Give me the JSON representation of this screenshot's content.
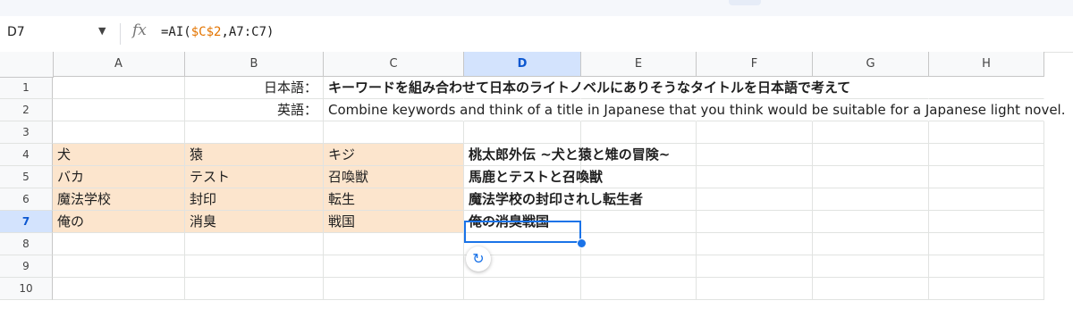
{
  "name_box": "D7",
  "formula_bar": {
    "fx_label": "fx",
    "formula_prefix": "=AI(",
    "formula_ref1": "$C$2",
    "formula_sep": ",",
    "formula_ref2": "A7:C7",
    "formula_suffix": ")"
  },
  "columns": [
    "A",
    "B",
    "C",
    "D",
    "E",
    "F",
    "G",
    "H"
  ],
  "rows": [
    "1",
    "2",
    "3",
    "4",
    "5",
    "6",
    "7",
    "8",
    "9",
    "10"
  ],
  "cells": {
    "B1": "日本語：",
    "C1": "キーワードを組み合わせて日本のライトノベルにありそうなタイトルを日本語で考えて",
    "B2": "英語：",
    "C2": "Combine keywords and think of a title in Japanese that you think would be suitable for a Japanese light novel.",
    "A4": "犬",
    "B4": "猿",
    "C4": "キジ",
    "D4": "桃太郎外伝 ~犬と猿と雉の冒険~",
    "A5": "バカ",
    "B5": "テスト",
    "C5": "召喚獣",
    "D5": "馬鹿とテストと召喚獣",
    "A6": "魔法学校",
    "B6": "封印",
    "C6": "転生",
    "D6": "魔法学校の封印されし転生者",
    "A7": "俺の",
    "B7": "消臭",
    "C7": "戦国",
    "D7": "俺の消臭戦国"
  },
  "colors": {
    "input_fill": "#fce5cd",
    "selection": "#1a73e8",
    "header_selected": "#d3e3fd",
    "formula_ref_color": "#e37400"
  },
  "icons": {
    "name_box_dropdown": "caret-down-icon",
    "formula": "fx-icon",
    "refresh": "refresh-icon"
  }
}
